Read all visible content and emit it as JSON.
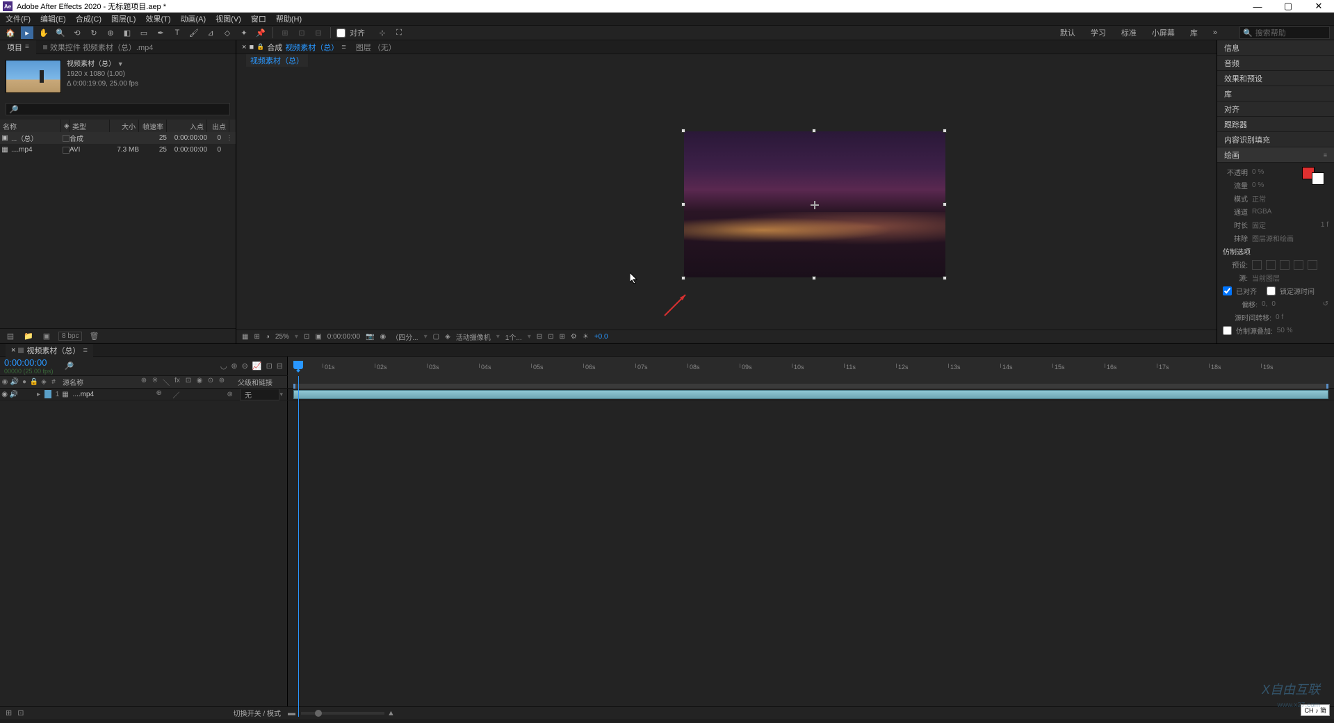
{
  "title": "Adobe After Effects 2020 - 无标题项目.aep *",
  "menu": [
    "文件(F)",
    "编辑(E)",
    "合成(C)",
    "图层(L)",
    "效果(T)",
    "动画(A)",
    "视图(V)",
    "窗口",
    "帮助(H)"
  ],
  "toolbar": {
    "align_label": "对齐",
    "workspaces": [
      "默认",
      "学习",
      "标准",
      "小屏幕",
      "库"
    ],
    "search_placeholder": "搜索帮助"
  },
  "project": {
    "tab1": "项目",
    "tab2": "效果控件 视频素材（总）.mp4",
    "name": "视频素材（总）",
    "dims": "1920 x 1080 (1.00)",
    "duration": "Δ 0:00:19:09, 25.00 fps",
    "cols": {
      "name": "名称",
      "type": "类型",
      "size": "大小",
      "fps": "帧速率",
      "in": "入点",
      "out": "出点"
    },
    "rows": [
      {
        "name": "...（总）",
        "type": "合成",
        "size": "",
        "fps": "25",
        "in": "0:00:00:00",
        "out": "0"
      },
      {
        "name": "....mp4",
        "type": "AVI",
        "size": "7.3 MB",
        "fps": "25",
        "in": "0:00:00:00",
        "out": "0"
      }
    ],
    "bpc": "8 bpc"
  },
  "composition": {
    "tab_prefix": "合成",
    "tab_name": "视频素材（总）",
    "tab2": "图层 （无）",
    "breadcrumb": "视频素材（总）",
    "footer": {
      "zoom": "25%",
      "time": "0:00:00:00",
      "quality": "（四分...",
      "camera": "活动摄像机",
      "views": "1个...",
      "exposure": "+0.0"
    }
  },
  "right_panels": {
    "info": "信息",
    "audio": "音频",
    "effects": "效果和预设",
    "library": "库",
    "align": "对齐",
    "tracker": "跟踪器",
    "content_aware": "内容识别填充",
    "paint": "绘画",
    "paint_props": {
      "opacity_lbl": "不透明",
      "opacity_val": "0 %",
      "flow_lbl": "流量",
      "flow_val": "0 %",
      "mode_lbl": "模式",
      "mode_val": "正常",
      "channel_lbl": "通道",
      "channel_val": "RGBA",
      "duration_lbl": "时长",
      "duration_val": "固定",
      "duration_frames": "1 f",
      "erase_lbl": "抹除",
      "erase_val": "图层源和绘画",
      "clone_header": "仿制选项",
      "preset_lbl": "预设:",
      "source_lbl": "源:",
      "source_val": "当前图层",
      "aligned": "已对齐",
      "lock_time": "锁定源时间",
      "offset_lbl": "偏移:",
      "offset_x": "0,",
      "offset_y": "0",
      "src_time_lbl": "源时间转移:",
      "src_time_val": "0 f",
      "clone_overlay": "仿制源叠加:",
      "clone_overlay_val": "50 %"
    }
  },
  "timeline": {
    "tab": "视频素材（总）",
    "time": "0:00:00:00",
    "subtime": "00000 (25.00 fps)",
    "col_source": "源名称",
    "col_parent": "父级和链接",
    "ticks": [
      "01s",
      "02s",
      "03s",
      "04s",
      "05s",
      "06s",
      "07s",
      "08s",
      "09s",
      "10s",
      "11s",
      "12s",
      "13s",
      "14s",
      "15s",
      "16s",
      "17s",
      "18s",
      "19s"
    ],
    "layer": {
      "idx": "1",
      "name": "....mp4",
      "parent": "无"
    },
    "footer_label": "切换开关 / 模式"
  },
  "ime": "CH ♪ 简",
  "watermark": "X自由互联",
  "watermark2": "www.x27.com"
}
